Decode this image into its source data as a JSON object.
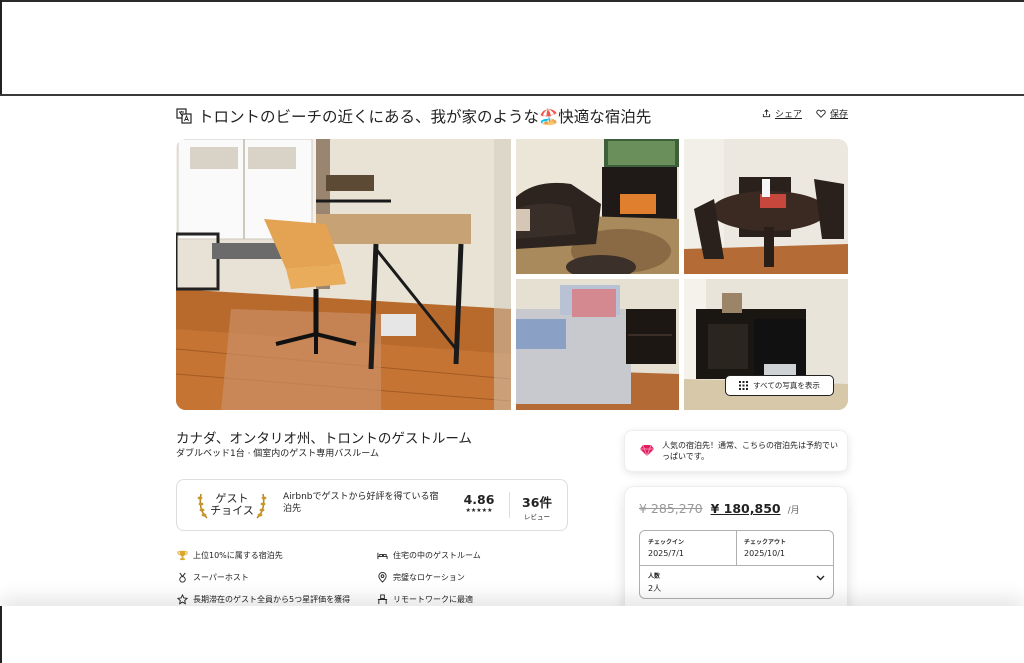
{
  "listing": {
    "title": "トロントのビーチの近くにある、我が家のような🏖️快適な宿泊先",
    "share_label": "シェア",
    "save_label": "保存",
    "show_all_photos": "すべての写真を表示",
    "location": "カナダ、オンタリオ州、トロントのゲストルーム",
    "subtitle": "ダブルベッド1台 · 個室内のゲスト専用バスルーム"
  },
  "guest_choice": {
    "badge_line1": "ゲスト",
    "badge_line2": "チョイス",
    "description": "Airbnbでゲストから好評を得ている宿泊先",
    "rating": "4.86",
    "stars": "★★★★★",
    "review_count": "36件",
    "review_label": "レビュー"
  },
  "features": [
    {
      "icon": "trophy-icon",
      "label": "上位10%に属する宿泊先"
    },
    {
      "icon": "bed-icon",
      "label": "住宅の中のゲストルーム"
    },
    {
      "icon": "medal-icon",
      "label": "スーパーホスト"
    },
    {
      "icon": "location-pin-icon",
      "label": "完璧なロケーション"
    },
    {
      "icon": "star-icon",
      "label": "長期滞在のゲスト全員から5つ星評価を獲得"
    },
    {
      "icon": "desk-icon",
      "label": "リモートワークに最適"
    }
  ],
  "popular": {
    "text": "人気の宿泊先！通常、こちらの宿泊先は予約でいっぱいです。"
  },
  "booking": {
    "old_price": "¥ 285,270",
    "new_price": "¥ 180,850",
    "per": "/月",
    "checkin_label": "チェックイン",
    "checkin_value": "2025/7/1",
    "checkout_label": "チェックアウト",
    "checkout_value": "2025/10/1",
    "guests_label": "人数",
    "guests_value": "2人"
  },
  "colors": {
    "brand": "#e31c5f",
    "text": "#222222",
    "muted": "#717171",
    "border": "#dddddd"
  }
}
